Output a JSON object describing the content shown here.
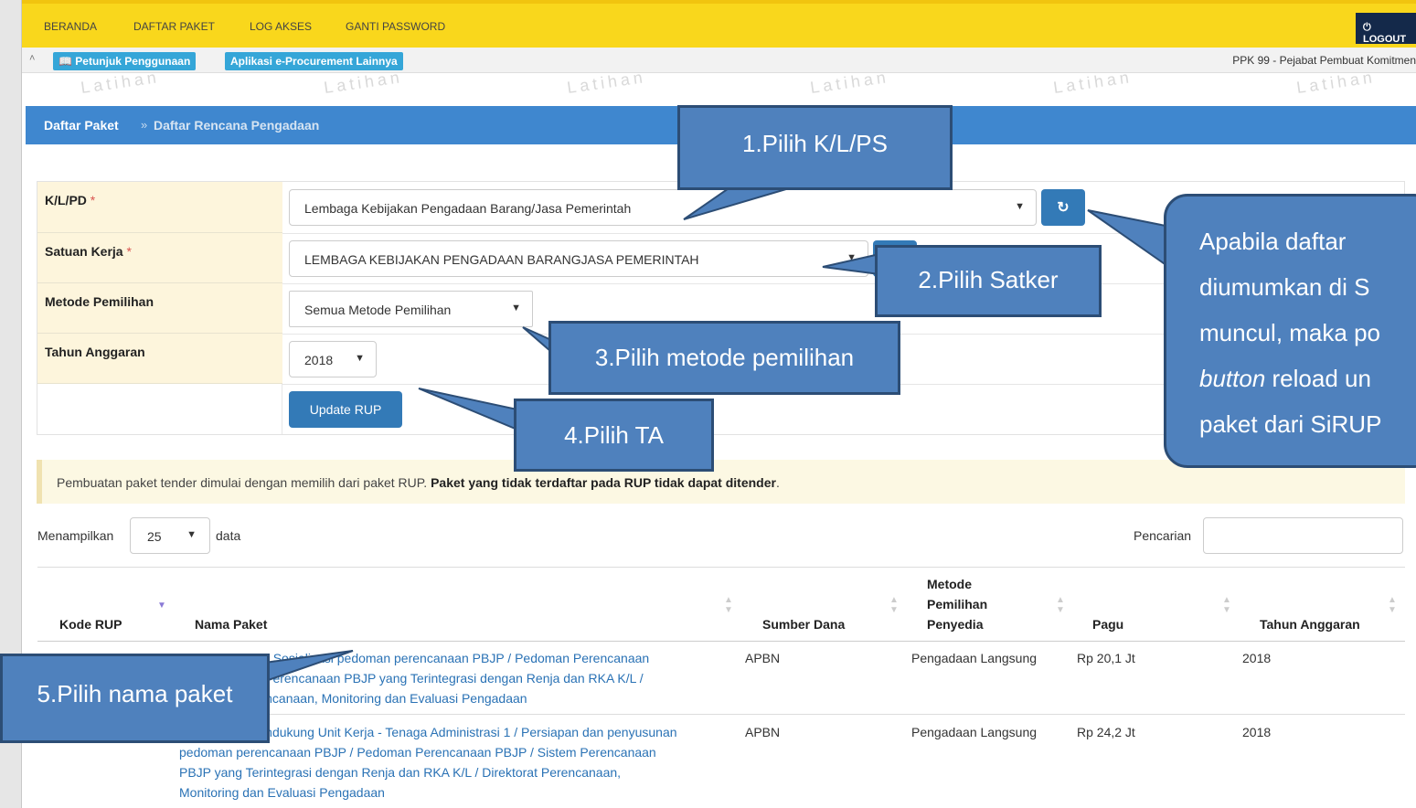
{
  "topnav": {
    "items": [
      "BERANDA",
      "DAFTAR PAKET",
      "LOG AKSES",
      "GANTI PASSWORD"
    ],
    "logout": "LOGOUT"
  },
  "subbar": {
    "petunjuk": "Petunjuk Penggunaan",
    "aplikasi": "Aplikasi e-Procurement Lainnya",
    "user": "PPK 99 - Pejabat Pembuat Komitmen"
  },
  "watermark": "Latihan",
  "breadcrumb": {
    "root": "Daftar Paket",
    "separator": "»",
    "current": "Daftar Rencana Pengadaan"
  },
  "form": {
    "klpd_label": "K/L/PD",
    "klpd_value": "Lembaga Kebijakan Pengadaan Barang/Jasa Pemerintah",
    "satker_label": "Satuan Kerja",
    "satker_value": "LEMBAGA KEBIJAKAN PENGADAAN BARANGJASA PEMERINTAH",
    "metode_label": "Metode Pemilihan",
    "metode_value": "Semua Metode Pemilihan",
    "tahun_label": "Tahun Anggaran",
    "tahun_value": "2018",
    "required_mark": "*",
    "update_button": "Update RUP"
  },
  "alert": {
    "text": "Pembuatan paket tender dimulai dengan memilih dari paket RUP.",
    "bold": "Paket yang tidak terdaftar pada RUP tidak dapat ditender",
    "end": "."
  },
  "table_controls": {
    "show_label": "Menampilkan",
    "show_value": "25",
    "show_after": "data",
    "search_label": "Pencarian"
  },
  "table": {
    "headers": {
      "kode": "Kode RUP",
      "nama": "Nama Paket",
      "sumber": "Sumber Dana",
      "metode_1": "Metode",
      "metode_2": "Pemilihan",
      "metode_3": "Penyedia",
      "pagu": "Pagu",
      "tahun": "Tahun Anggaran"
    },
    "rows": [
      {
        "nama_1": "Jamuan Rapat / Sosialisasi pedoman perencanaan PBJP / Pedoman Perencanaan",
        "nama_2": "PBJP / Sistem Perencanaan PBJP yang Terintegrasi dengan Renja dan RKA K/L /",
        "nama_3": "Direktorat Perencanaan, Monitoring dan Evaluasi Pengadaan",
        "sumber": "APBN",
        "metode": "Pengadaan Langsung",
        "pagu": "Rp 20,1 Jt",
        "tahun": "2018"
      },
      {
        "nama_1": "Honorarium Pendukung Unit Kerja - Tenaga Administrasi 1 / Persiapan dan penyusunan",
        "nama_2": "pedoman perencanaan PBJP / Pedoman Perencanaan PBJP / Sistem Perencanaan",
        "nama_3": "PBJP yang Terintegrasi dengan Renja dan RKA K/L / Direktorat Perencanaan,",
        "nama_4": "Monitoring dan Evaluasi Pengadaan",
        "sumber": "APBN",
        "metode": "Pengadaan Langsung",
        "pagu": "Rp 24,2 Jt",
        "tahun": "2018"
      }
    ]
  },
  "callouts": {
    "c1": "1.Pilih K/L/PS",
    "c2": "2.Pilih Satker",
    "c3": "3.Pilih metode pemilihan",
    "c4": "4.Pilih TA",
    "c5": "5.Pilih nama paket",
    "big_1": "Apabila daftar",
    "big_2": "diumumkan di S",
    "big_3": "muncul, maka po",
    "big_4a": "button",
    "big_4b": " reload un",
    "big_5": "paket dari SiRUP"
  },
  "colors": {
    "nav_yellow": "#f9d71c",
    "breadcrumb_blue": "#3f87cf",
    "button_blue": "#337ab7",
    "callout_blue": "#4f81bd",
    "link_blue": "#2a72b5"
  }
}
